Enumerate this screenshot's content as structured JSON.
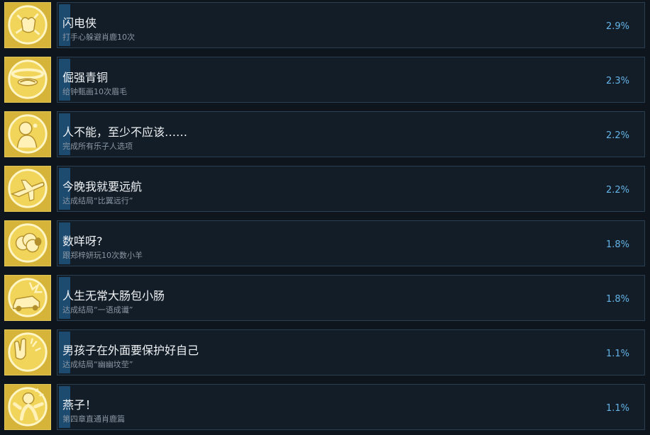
{
  "colors": {
    "background": "#0f151c",
    "panel": "#131d27",
    "panel_border": "#2a3f51",
    "progress_fill": "#1d4a6f",
    "icon_gold": "#d6b43a",
    "percent_text": "#64b4e8"
  },
  "achievements": [
    {
      "title": "闪电侠",
      "description": "打手心躲避肖鹿10次",
      "percent": "2.9%",
      "percent_value": 2.9,
      "icon": "slap-hands-icon"
    },
    {
      "title": "倔强青铜",
      "description": "给钟甄画10次眉毛",
      "percent": "2.3%",
      "percent_value": 2.3,
      "icon": "eyebrow-icon"
    },
    {
      "title": "人不能，至少不应该……",
      "description": "完成所有乐子人选项",
      "percent": "2.2%",
      "percent_value": 2.2,
      "icon": "thinking-person-icon"
    },
    {
      "title": "今晚我就要远航",
      "description": "达成结局“比翼远行”",
      "percent": "2.2%",
      "percent_value": 2.2,
      "icon": "airplane-icon"
    },
    {
      "title": "数咩呀?",
      "description": "跟郑梓妍玩10次数小羊",
      "percent": "1.8%",
      "percent_value": 1.8,
      "icon": "sheep-icon"
    },
    {
      "title": "人生无常大肠包小肠",
      "description": "达成结局“一语成谶”",
      "percent": "1.8%",
      "percent_value": 1.8,
      "icon": "car-crash-icon"
    },
    {
      "title": "男孩子在外面要保护好自己",
      "description": "达成结局“幽幽坟茔”",
      "percent": "1.1%",
      "percent_value": 1.1,
      "icon": "raised-hands-icon"
    },
    {
      "title": "燕子！",
      "description": "第四章直通肖鹿篇",
      "percent": "1.1%",
      "percent_value": 1.1,
      "icon": "running-figure-icon"
    }
  ]
}
